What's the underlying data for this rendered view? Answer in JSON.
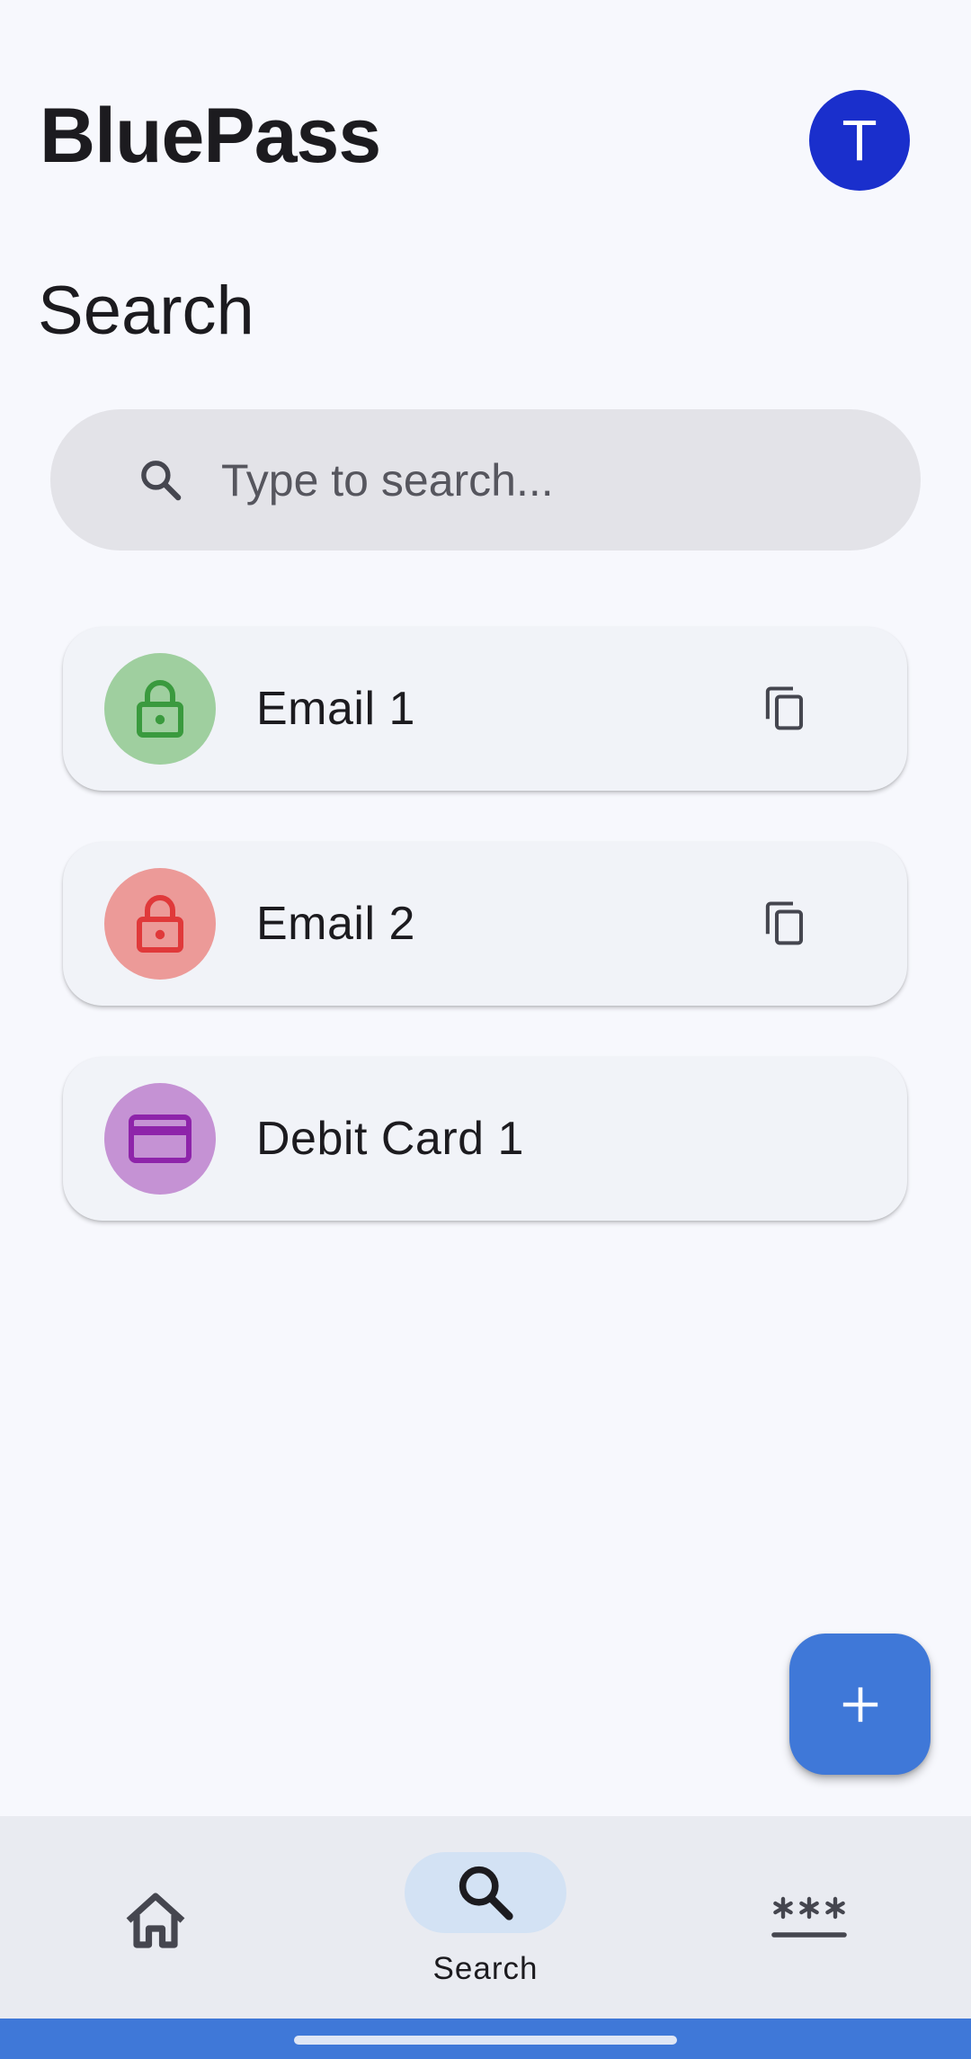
{
  "app": {
    "title": "BluePass",
    "avatar_initial": "T"
  },
  "page": {
    "title": "Search"
  },
  "search": {
    "placeholder": "Type to search..."
  },
  "entries": [
    {
      "label": "Email 1",
      "icon": "lock-icon",
      "badge_bg": "#9fcf9f",
      "icon_color": "#3a9a3e",
      "copy": true
    },
    {
      "label": "Email 2",
      "icon": "lock-icon",
      "badge_bg": "#ec9a98",
      "icon_color": "#e0393a",
      "copy": true
    },
    {
      "label": "Debit Card 1",
      "icon": "credit-card-icon",
      "badge_bg": "#c592d4",
      "icon_color": "#8e24aa",
      "copy": false
    }
  ],
  "fab": {
    "icon": "plus-icon"
  },
  "bottom_nav": {
    "items": [
      {
        "id": "home",
        "icon": "home-icon",
        "label": ""
      },
      {
        "id": "search",
        "icon": "search-icon",
        "label": "Search",
        "active": true
      },
      {
        "id": "passwords",
        "icon": "password-icon",
        "label": ""
      }
    ]
  },
  "colors": {
    "background": "#f7f8fd",
    "avatar": "#1a2fcc",
    "accent": "#3f78d8",
    "nav_active_pill": "#d3e2f4",
    "nav_background": "#e9ebf1"
  }
}
